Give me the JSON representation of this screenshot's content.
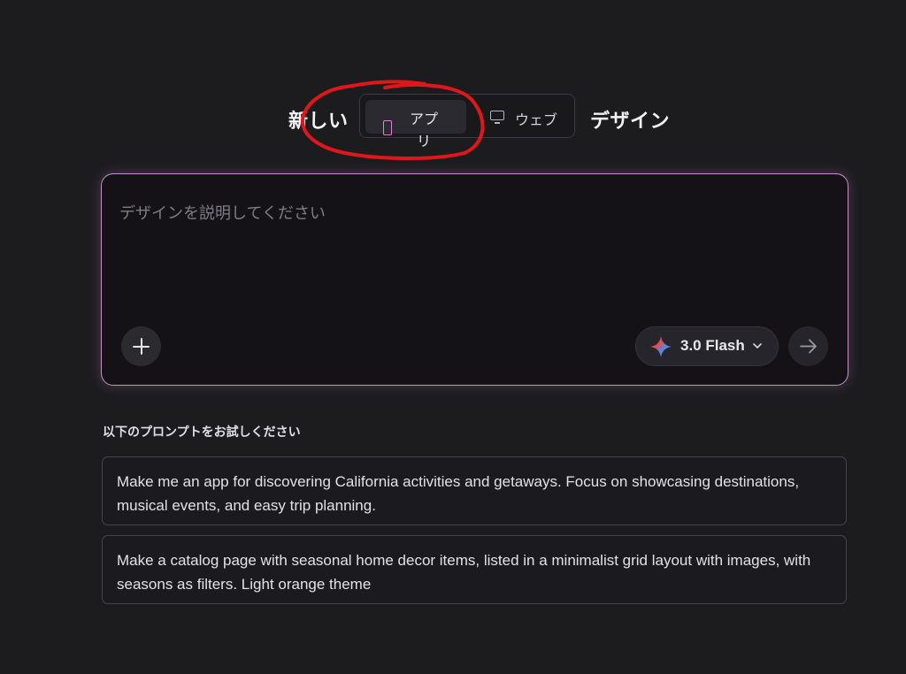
{
  "colors": {
    "background": "#1c1c1f",
    "prompt_border": "#c792c9",
    "app_icon": "#e37fd6",
    "annotation": "#e0161b"
  },
  "heading": {
    "left_word": "新しい",
    "right_word": "デザイン"
  },
  "mode_toggle": {
    "options": [
      {
        "label": "アプリ",
        "icon": "phone-icon",
        "selected": true
      },
      {
        "label": "ウェブ",
        "icon": "monitor-icon",
        "selected": false
      }
    ]
  },
  "prompt": {
    "placeholder": "デザインを説明してください",
    "value": ""
  },
  "toolbar": {
    "add_icon": "plus-icon",
    "model_label": "3.0 Flash",
    "model_icon": "sparkle-icon",
    "send_icon": "arrow-right-icon"
  },
  "suggestions": {
    "heading": "以下のプロンプトをお試しください",
    "items": [
      {
        "text": "Make me an app for discovering California activities and getaways. Focus on showcasing destinations, musical events, and easy trip planning."
      },
      {
        "text": "Make a catalog page with seasonal home decor items, listed in a minimalist grid layout with images, with seasons as filters. Light orange theme"
      }
    ]
  }
}
